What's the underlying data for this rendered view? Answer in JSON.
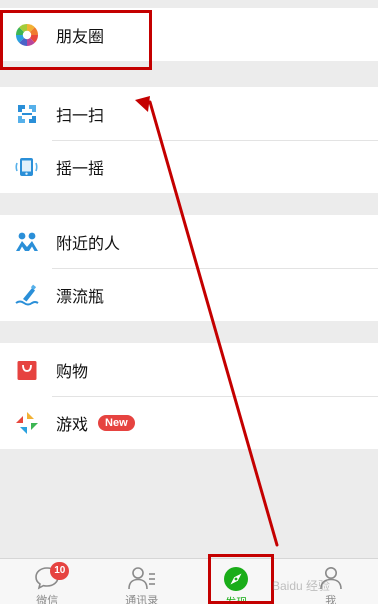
{
  "menu": {
    "moments_label": "朋友圈",
    "scan_label": "扫一扫",
    "shake_label": "摇一摇",
    "nearby_label": "附近的人",
    "bottle_label": "漂流瓶",
    "shopping_label": "购物",
    "games_label": "游戏",
    "games_badge": "New"
  },
  "tabs": {
    "chats_label": "微信",
    "chats_badge": "10",
    "contacts_label": "通讯录",
    "discover_label": "发现",
    "me_label": "我"
  },
  "watermark": "Baidu 经验",
  "colors": {
    "accent_green": "#1aad19",
    "badge_red": "#e64340",
    "annotation_red": "#c40000",
    "icon_blue": "#2a8fd8"
  },
  "icons": {
    "moments": "moments-icon",
    "scan": "scan-icon",
    "shake": "shake-icon",
    "nearby": "people-nearby-icon",
    "bottle": "drift-bottle-icon",
    "shopping": "shopping-bag-icon",
    "games": "games-icon",
    "chats": "chat-bubble-icon",
    "contacts": "contacts-icon",
    "discover": "compass-icon",
    "me": "person-icon"
  }
}
